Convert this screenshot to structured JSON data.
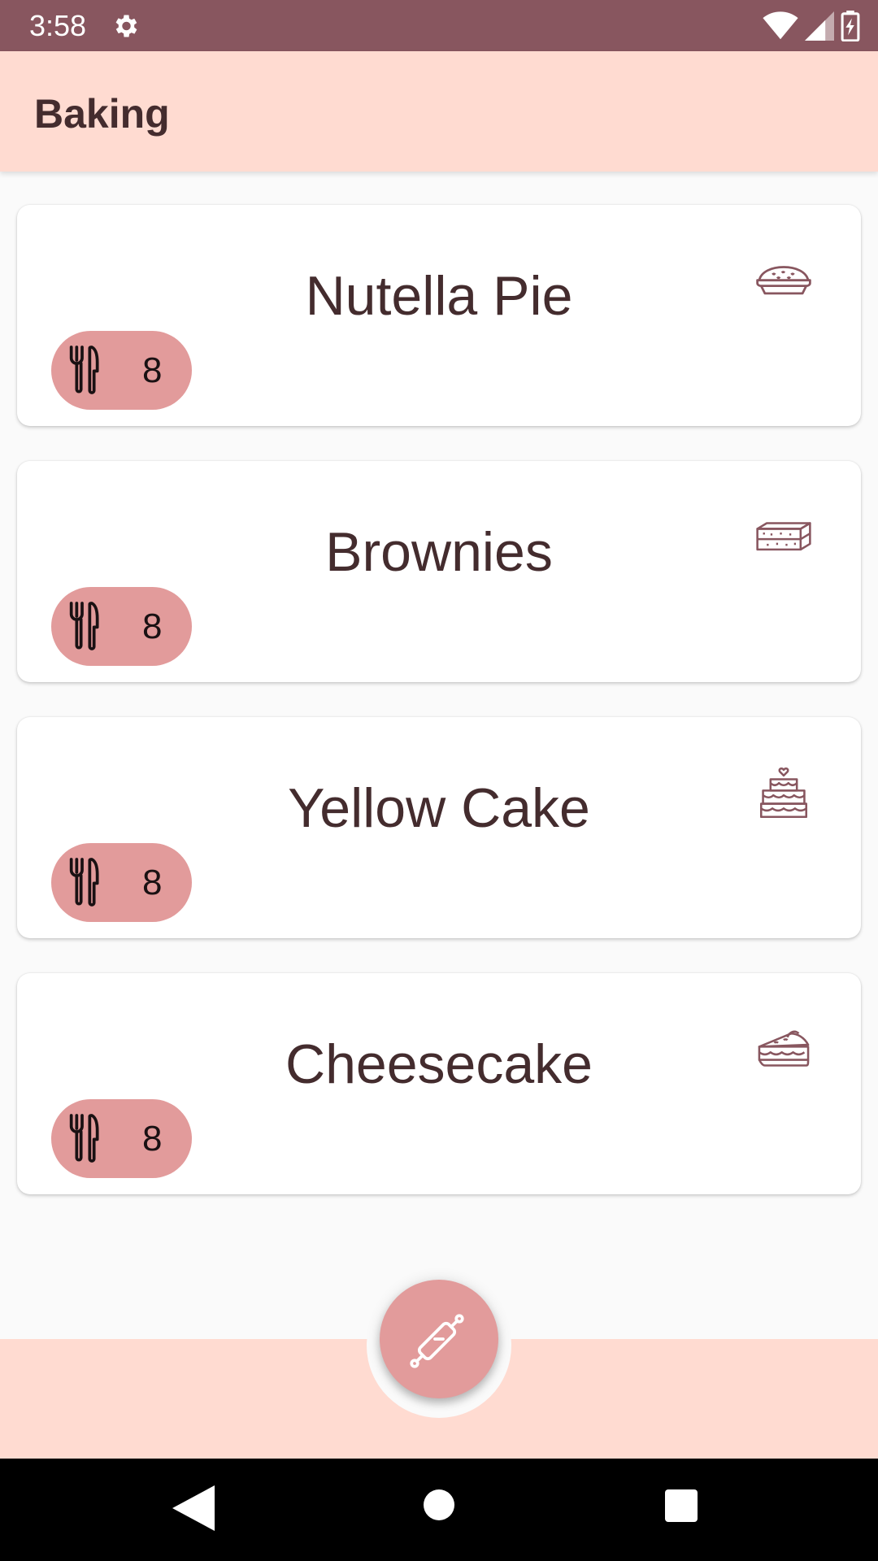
{
  "status_bar": {
    "time": "3:58"
  },
  "app_bar": {
    "title": "Baking"
  },
  "recipes": [
    {
      "name": "Nutella Pie",
      "servings": "8",
      "icon": "pie-icon"
    },
    {
      "name": "Brownies",
      "servings": "8",
      "icon": "brownie-icon"
    },
    {
      "name": "Yellow Cake",
      "servings": "8",
      "icon": "layer-cake-icon"
    },
    {
      "name": "Cheesecake",
      "servings": "8",
      "icon": "cheesecake-slice-icon"
    }
  ],
  "fab": {
    "icon": "rolling-pin-icon"
  },
  "colors": {
    "status_bar": "#88565F",
    "app_bar": "#FFDBD1",
    "accent": "#E29B9B",
    "text": "#442C2E",
    "background": "#FAFAFA"
  }
}
